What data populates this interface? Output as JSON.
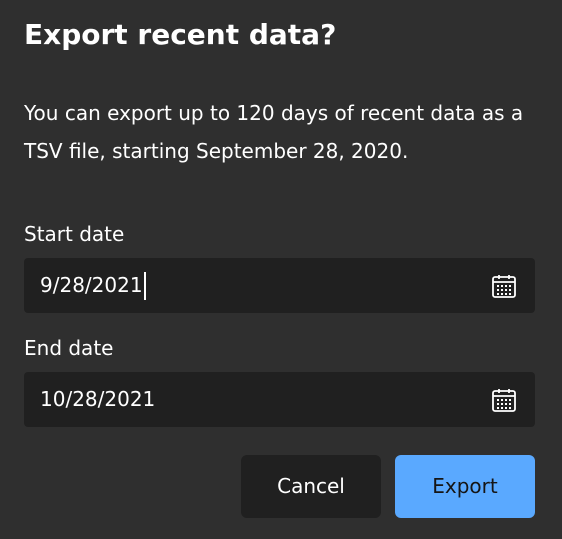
{
  "dialog": {
    "title": "Export recent data?",
    "description": "You can export up to 120 days of recent data as a TSV file, starting September 28, 2020."
  },
  "start_date": {
    "label": "Start date",
    "value": "9/28/2021",
    "icon": "calendar-icon"
  },
  "end_date": {
    "label": "End date",
    "value": "10/28/2021",
    "icon": "calendar-icon"
  },
  "buttons": {
    "cancel_label": "Cancel",
    "export_label": "Export"
  },
  "colors": {
    "background": "#2f2f2f",
    "input_background": "#202020",
    "primary": "#5aa9ff",
    "text": "#ffffff"
  }
}
